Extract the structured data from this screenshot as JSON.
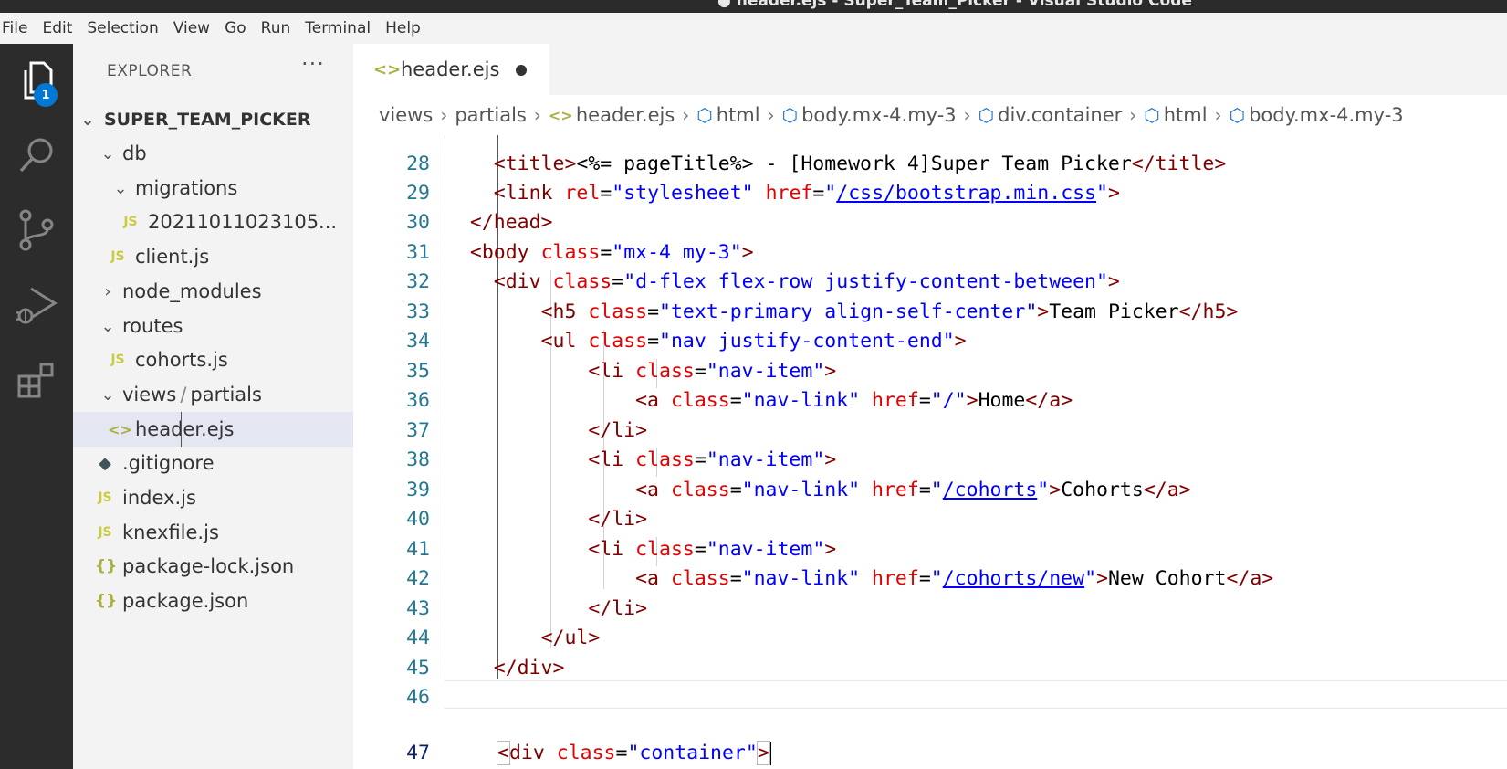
{
  "window": {
    "title": "● header.ejs - Super_Team_Picker - Visual Studio Code"
  },
  "menu": {
    "items": [
      "File",
      "Edit",
      "Selection",
      "View",
      "Go",
      "Run",
      "Terminal",
      "Help"
    ]
  },
  "activity": {
    "explorer_badge": "1"
  },
  "explorer": {
    "title": "EXPLORER",
    "more": "···",
    "root": "SUPER_TEAM_PICKER",
    "items": [
      {
        "label": "db"
      },
      {
        "label": "migrations"
      },
      {
        "label": "2021101102310 5...",
        "display": "2021101102310 5..."
      },
      {
        "label": "client.js"
      },
      {
        "label": "node_modules"
      },
      {
        "label": "routes"
      },
      {
        "label": "cohorts.js"
      },
      {
        "label": "views",
        "label2": "partials"
      },
      {
        "label": "header.ejs"
      },
      {
        "label": ".gitignore"
      },
      {
        "label": "index.js"
      },
      {
        "label": "knexfile.js"
      },
      {
        "label": "package-lock.json"
      },
      {
        "label": "package.json"
      }
    ],
    "icons": {
      "js": "JS",
      "ejs": "<>",
      "json": "{}",
      "git": "◆"
    }
  },
  "tab": {
    "label": "header.ejs"
  },
  "breadcrumb": [
    "views",
    "partials",
    "header.ejs",
    "html",
    "body.mx-4.my-3",
    "div.container",
    "html",
    "body.mx-4.my-3"
  ],
  "code": {
    "line_numbers": [
      "28",
      "29",
      "30",
      "31",
      "32",
      "33",
      "34",
      "35",
      "36",
      "37",
      "38",
      "39",
      "40",
      "41",
      "42",
      "43",
      "44",
      "45",
      "46",
      "47"
    ]
  }
}
